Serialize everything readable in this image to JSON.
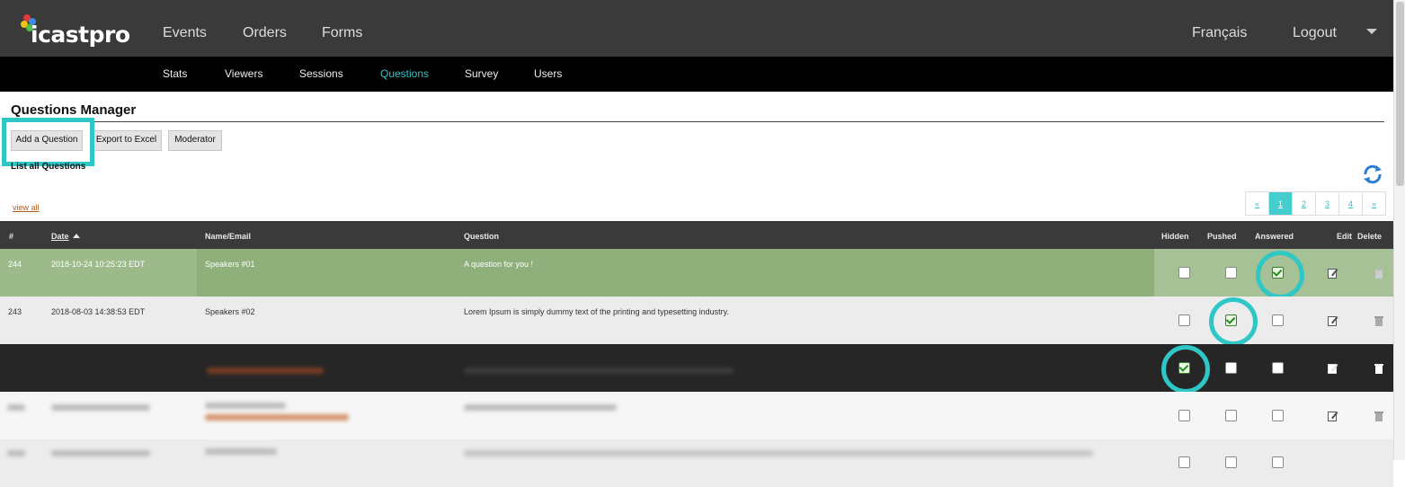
{
  "brand": {
    "logo_text": "icastpro"
  },
  "topnav": {
    "items": [
      "Events",
      "Orders",
      "Forms"
    ],
    "language": "Français",
    "logout": "Logout"
  },
  "subnav": {
    "items": [
      "Stats",
      "Viewers",
      "Sessions",
      "Questions",
      "Survey",
      "Users"
    ],
    "active": "Questions"
  },
  "page": {
    "title": "Questions Manager",
    "buttons": {
      "add": "Add a Question",
      "export": "Export to Excel",
      "moderator": "Moderator"
    },
    "list_label": "List all Questions",
    "view_all": "view all"
  },
  "pager": {
    "prev": "«",
    "pages": [
      "1",
      "2",
      "3",
      "4"
    ],
    "next": "»",
    "current": "1"
  },
  "table": {
    "headers": {
      "id": "#",
      "date": "Date",
      "name": "Name/Email",
      "question": "Question",
      "hidden": "Hidden",
      "pushed": "Pushed",
      "answered": "Answered",
      "edit": "Edit",
      "delete": "Delete"
    },
    "rows": [
      {
        "id": "244",
        "date": "2018-10-24 10:25:23 EDT",
        "name": "Speakers #01",
        "question": "A question for you !",
        "hidden": false,
        "pushed": false,
        "answered": true
      },
      {
        "id": "243",
        "date": "2018-08-03 14:38:53 EDT",
        "name": "Speakers #02",
        "question": "Lorem Ipsum is simply dummy text of the printing and typesetting industry.",
        "hidden": false,
        "pushed": true,
        "answered": false
      },
      {
        "hidden": true,
        "pushed": false,
        "answered": false
      },
      {
        "hidden": false,
        "pushed": false,
        "answered": false
      },
      {
        "hidden": false,
        "pushed": false,
        "answered": false
      }
    ]
  },
  "colors": {
    "accent": "#2fc6c6",
    "topbar": "#3a3a3a",
    "answered_row": "#9dba8a",
    "link": "#b55a1f"
  }
}
